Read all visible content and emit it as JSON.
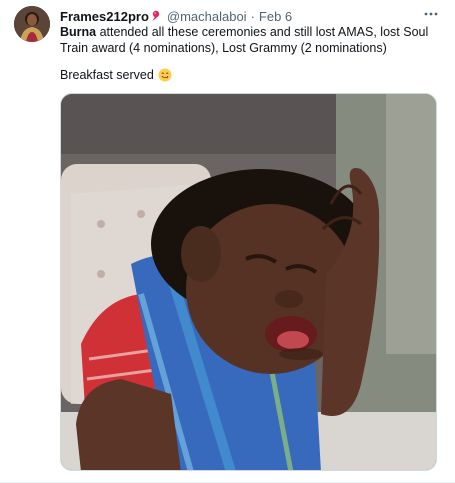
{
  "tweet": {
    "author_name": "Frames212pro",
    "author_handle": "@machalaboi",
    "separator": "·",
    "date": "Feb 6",
    "text_bold": "Burna",
    "text_rest": " attended all these ceremonies and still lost AMAS, lost Soul Train award (4 nominations), Lost Grammy (2 nominations)",
    "text_line2": "Breakfast served",
    "icons": {
      "pin": "pin-icon",
      "more": "more-icon",
      "emoji": "yum-face-emoji"
    },
    "media_description_visible": false
  },
  "colors": {
    "text_primary": "#0f1419",
    "text_secondary": "#536471",
    "border": "#cfd9de",
    "pin_red": "#e0245e"
  }
}
